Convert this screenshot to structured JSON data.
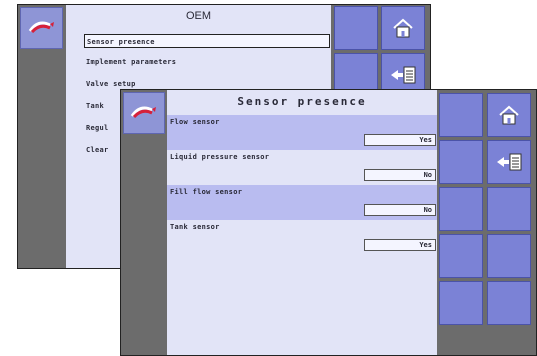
{
  "colors": {
    "screen_bg": "#e2e4f7",
    "sidebar_gray": "#6c6c6c",
    "soft_key_blue": "#7b82d6",
    "row_highlight": "#b9bcf0",
    "value_box": "#f4f5ff"
  },
  "back_screen": {
    "title": "OEM",
    "menu": [
      {
        "label": "Sensor presence",
        "selected": true
      },
      {
        "label": "Implement parameters"
      },
      {
        "label": "Valve setup"
      },
      {
        "label": "Tank"
      },
      {
        "label": "Regul"
      },
      {
        "label": "Clear"
      }
    ],
    "soft_keys": [
      {
        "icon": "home-icon"
      },
      {
        "icon": "back-to-list-icon"
      }
    ]
  },
  "front_screen": {
    "title": "Sensor presence",
    "settings": [
      {
        "label": "Flow sensor",
        "value": "Yes",
        "highlighted": true
      },
      {
        "label": "Liquid pressure sensor",
        "value": "No",
        "highlighted": false
      },
      {
        "label": "Fill flow sensor",
        "value": "No",
        "highlighted": true
      },
      {
        "label": "Tank sensor",
        "value": "Yes",
        "highlighted": false
      }
    ],
    "soft_keys": [
      {
        "icon": "home-icon"
      },
      {
        "icon": "back-to-list-icon"
      }
    ]
  }
}
